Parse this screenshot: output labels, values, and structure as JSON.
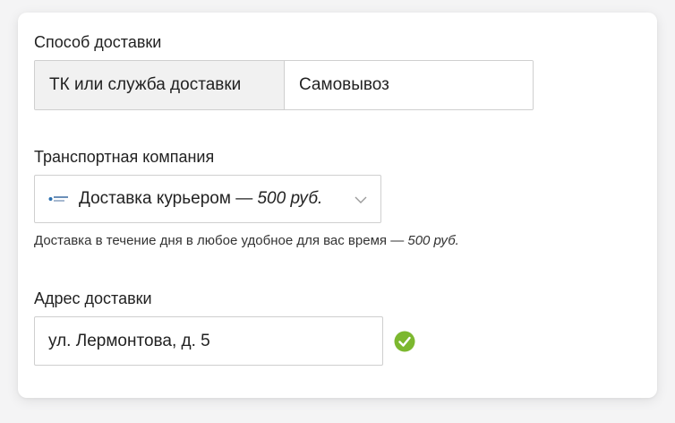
{
  "delivery_method": {
    "label": "Способ доставки",
    "options": [
      {
        "label": "ТК или служба доставки",
        "active": true
      },
      {
        "label": "Самовывоз",
        "active": false
      }
    ]
  },
  "transport": {
    "label": "Транспортная компания",
    "selected_name": "Доставка курьером — ",
    "selected_price": "500 руб.",
    "logo_icon": "courier-logo-icon",
    "chevron_icon": "chevron-down-icon",
    "hint_text": "Доставка в течение дня в любое удобное для вас время — ",
    "hint_price": "500 руб."
  },
  "address": {
    "label": "Адрес доставки",
    "value": "ул. Лермонтова, д. 5",
    "valid_icon": "check-circle-icon",
    "valid_color": "#7cb82f"
  },
  "colors": {
    "border": "#cfcfcf",
    "active_segment_bg": "#f1f1f1",
    "text": "#222222"
  }
}
